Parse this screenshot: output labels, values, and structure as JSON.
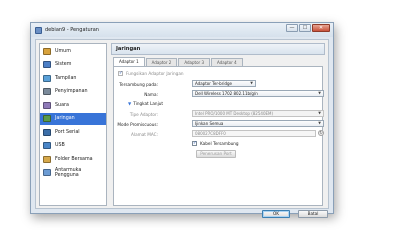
{
  "window": {
    "title": "debian9 - Pengaturan",
    "controls": {
      "minimize": "—",
      "maximize": "☐",
      "close": "✕"
    }
  },
  "sidebar": {
    "items": [
      {
        "label": "Umum",
        "icon": "general-icon",
        "color": "#d8a23c"
      },
      {
        "label": "Sistem",
        "icon": "system-icon",
        "color": "#4c7fc6"
      },
      {
        "label": "Tampilan",
        "icon": "display-icon",
        "color": "#5aa0d8"
      },
      {
        "label": "Penyimpanan",
        "icon": "storage-icon",
        "color": "#7b8a9a"
      },
      {
        "label": "Suara",
        "icon": "audio-icon",
        "color": "#8f7ab8"
      },
      {
        "label": "Jaringan",
        "icon": "network-icon",
        "color": "#5a9b4a",
        "selected": true
      },
      {
        "label": "Port Serial",
        "icon": "serial-port-icon",
        "color": "#3b6ea8"
      },
      {
        "label": "USB",
        "icon": "usb-icon",
        "color": "#4a86c8"
      },
      {
        "label": "Folder Bersama",
        "icon": "shared-folder-icon",
        "color": "#d6a84a"
      },
      {
        "label": "Antarmuka Pengguna",
        "icon": "user-interface-icon",
        "color": "#6c9cd4"
      }
    ]
  },
  "main": {
    "section_title": "Jaringan",
    "tabs": [
      "Adaptor 1",
      "Adaptor 2",
      "Adaptor 3",
      "Adaptor 4"
    ],
    "enable_adapter_label": "Fungsikan Adaptor Jaringan",
    "attached_to": {
      "label": "Tersambung pada:",
      "value": "Adaptor Ter-bridge"
    },
    "name": {
      "label": "Nama:",
      "value": "Dell Wireless 1702 802.11b/g/n"
    },
    "advanced_label": "Tingkat Lanjut",
    "adapter_type": {
      "label": "Tipe Adaptor:",
      "value": "Intel PRO/1000 MT Desktop (82540EM)"
    },
    "promiscuous_mode": {
      "label": "Mode Promiscuous:",
      "value": "Ijinkan Semua"
    },
    "mac_address": {
      "label": "Alamat MAC:",
      "value": "080027C8DFF0"
    },
    "cable_connected_label": "Kabel Tersambung",
    "port_forwarding_button": "Penerusan Port"
  },
  "footer": {
    "ok_label": "OK",
    "cancel_label": "Batal"
  },
  "colors": {
    "selection": "#3874d8",
    "window_frame": "#dfe7f0"
  }
}
